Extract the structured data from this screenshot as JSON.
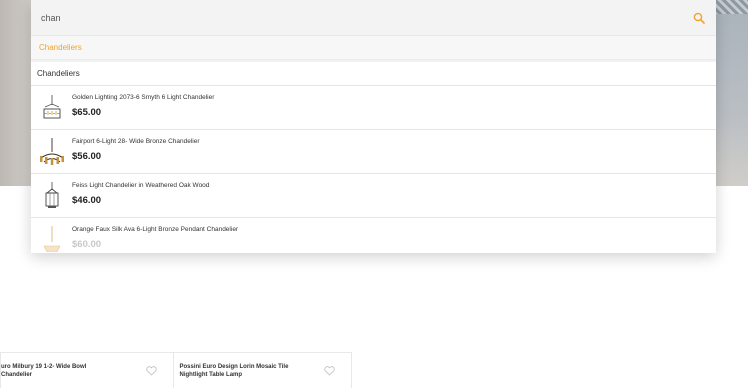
{
  "search": {
    "query": "chan",
    "suggestion": "Chandeliers"
  },
  "category_header": "Chandeliers",
  "results": [
    {
      "name": "Golden Lighting 2073-6 Smyth 6 Light Chandelier",
      "price": "$65.00",
      "icon": "chandelier-cage-icon"
    },
    {
      "name": "Fairport 6-Light 28- Wide Bronze Chandelier",
      "price": "$56.00",
      "icon": "chandelier-candle-icon"
    },
    {
      "name": "Feiss Light Chandelier in Weathered Oak Wood",
      "price": "$46.00",
      "icon": "lantern-icon"
    },
    {
      "name": "Orange Faux Silk Ava 6-Light Bronze Pendant Chandelier",
      "price": "$60.00",
      "icon": "pendant-icon"
    }
  ],
  "products": [
    {
      "title": "uro Milbury 19 1-2- Wide Bowl Chandelier"
    },
    {
      "title": "Possini Euro Design Lorin Mosaic Tile Nightlight Table Lamp"
    }
  ],
  "colors": {
    "accent": "#f0a32c",
    "text": "#333333",
    "price": "#222222"
  }
}
